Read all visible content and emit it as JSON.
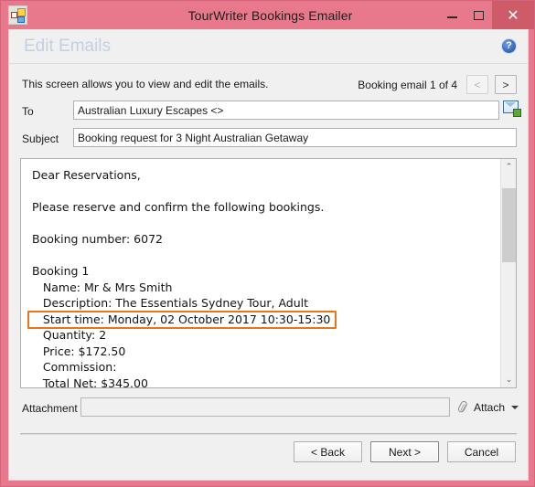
{
  "window": {
    "title": "TourWriter Bookings Emailer",
    "app_icon": "application-icon",
    "controls": {
      "minimize": "minimize-icon",
      "maximize": "maximize-icon",
      "close": "✕"
    },
    "titlebar_color": "#e8798d",
    "close_button_color": "#cd5c68"
  },
  "header": {
    "page_title": "Edit Emails",
    "page_title_color": "#c3d0e0",
    "help_icon": "help-icon",
    "help_glyph": "?"
  },
  "instruction": {
    "text": "This screen allows you to view and edit the emails."
  },
  "navigation": {
    "counter_label": "Booking email 1 of 4",
    "prev_label": "<",
    "next_label": ">",
    "prev_enabled": false,
    "next_enabled": true,
    "current": 1,
    "total": 4
  },
  "fields": {
    "to": {
      "label": "To",
      "value": "Australian Luxury Escapes <>",
      "placeholder": ""
    },
    "subject": {
      "label": "Subject",
      "value": "Booking request for 3 Night Australian Getaway",
      "placeholder": ""
    },
    "address_book_button": "add-recipient-icon"
  },
  "message": {
    "lines": [
      {
        "text": "Dear Reservations,",
        "highlighted": false
      },
      {
        "text": "",
        "highlighted": false
      },
      {
        "text": "Please reserve and confirm the following bookings.",
        "highlighted": false
      },
      {
        "text": "",
        "highlighted": false
      },
      {
        "text": "Booking number: 6072",
        "highlighted": false
      },
      {
        "text": "",
        "highlighted": false
      },
      {
        "text": "Booking 1",
        "highlighted": false
      },
      {
        "text": "   Name: Mr & Mrs Smith",
        "highlighted": false
      },
      {
        "text": "   Description: The Essentials Sydney Tour, Adult",
        "highlighted": false
      },
      {
        "text": "   Start time: Monday, 02 October 2017 10:30-15:30",
        "highlighted": true
      },
      {
        "text": "   Quantity: 2",
        "highlighted": false
      },
      {
        "text": "   Price: $172.50",
        "highlighted": false
      },
      {
        "text": "   Commission:",
        "highlighted": false
      },
      {
        "text": "   Total Net: $345.00",
        "highlighted": false
      }
    ],
    "highlight_color": "#e8741c",
    "scrollbar": {
      "up_arrow": "⌃",
      "down_arrow": "⌄",
      "thumb_top_pct": 7,
      "thumb_height_pct": 33
    }
  },
  "attachment": {
    "label": "Attachment",
    "value": "",
    "placeholder": "",
    "button_label": "Attach",
    "button_icon": "paperclip-icon",
    "button_caret": "chevron-down-icon"
  },
  "actions": {
    "back_label": "< Back",
    "next_label": "Next >",
    "cancel_label": "Cancel",
    "focused": "next"
  }
}
